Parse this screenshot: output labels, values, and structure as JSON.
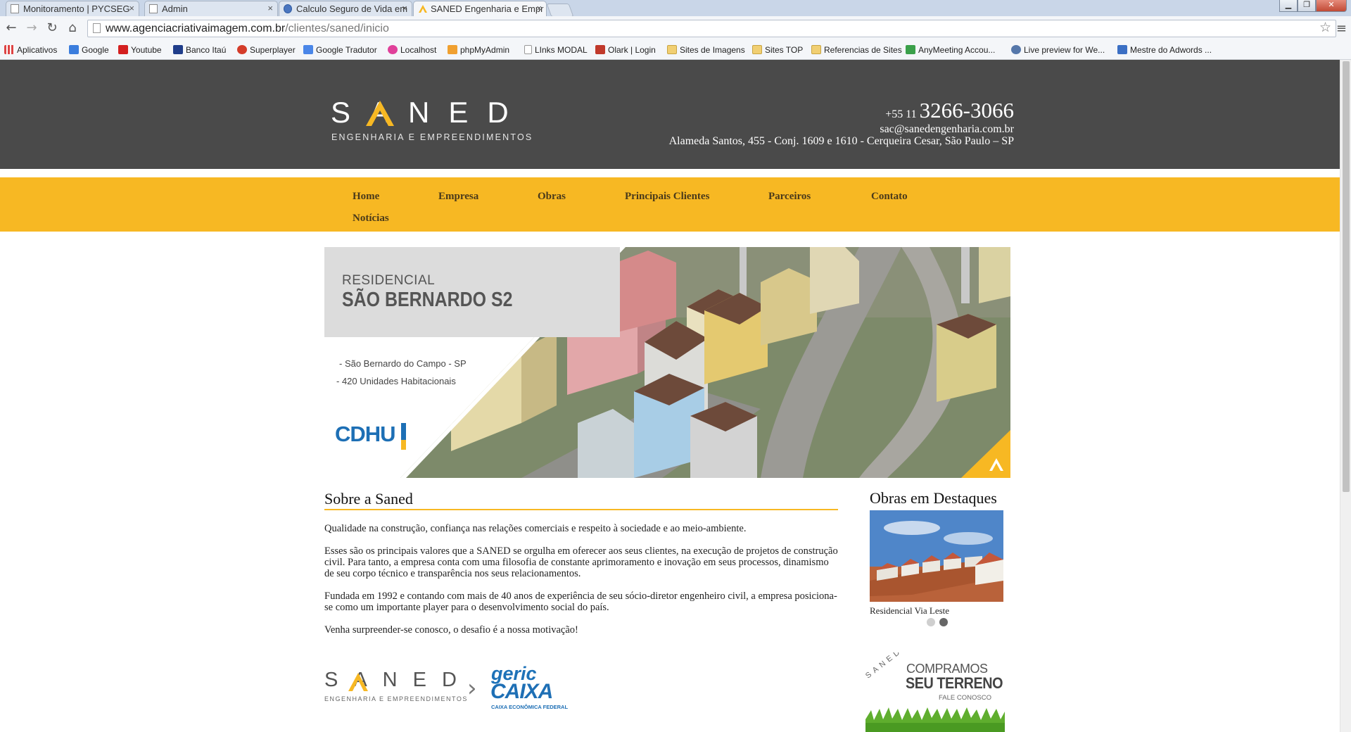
{
  "browser": {
    "tabs": [
      {
        "title": "Monitoramento | PYCSEG",
        "icon": "page-icon"
      },
      {
        "title": "Admin",
        "icon": "page-icon"
      },
      {
        "title": "Calculo Seguro de Vida em",
        "icon": "globe-icon"
      },
      {
        "title": "SANED Engenharia e Empr",
        "icon": "saned-logo-icon",
        "active": true
      }
    ],
    "tab_close_glyph": "×",
    "window_controls": {
      "minimize": "▁",
      "maximize": "❐",
      "close": "✕"
    },
    "url_host": "www.agenciacriativaimagem.com.br",
    "url_path": "/clientes/saned/inicio",
    "bookmarks": [
      {
        "label": "Aplicativos",
        "icon": "apps-icon"
      },
      {
        "label": "Google",
        "icon": "google-icon"
      },
      {
        "label": "Youtube",
        "icon": "youtube-icon"
      },
      {
        "label": "Banco Itaú",
        "icon": "itau-icon"
      },
      {
        "label": "Superplayer",
        "icon": "superplayer-icon"
      },
      {
        "label": "Google Tradutor",
        "icon": "translate-icon"
      },
      {
        "label": "Localhost",
        "icon": "localhost-icon"
      },
      {
        "label": "phpMyAdmin",
        "icon": "phpmyadmin-icon"
      },
      {
        "label": "LInks MODAL",
        "icon": "page-icon"
      },
      {
        "label": "Olark | Login",
        "icon": "olark-icon"
      },
      {
        "label": "Sites de Imagens",
        "icon": "folder-icon"
      },
      {
        "label": "Sites TOP",
        "icon": "folder-icon"
      },
      {
        "label": "Referencias de Sites",
        "icon": "folder-icon"
      },
      {
        "label": "AnyMeeting Accou...",
        "icon": "anymeeting-icon"
      },
      {
        "label": "Live preview for We...",
        "icon": "livepreview-icon"
      },
      {
        "label": "Mestre do Adwords ...",
        "icon": "adwords-icon"
      }
    ]
  },
  "header": {
    "logo_word": "SANED",
    "logo_tagline": "ENGENHARIA E EMPREENDIMENTOS",
    "phone_prefix": "+55 11",
    "phone_number": "3266-3066",
    "email": "sac@sanedengenharia.com.br",
    "address": "Alameda Santos, 455 - Conj. 1609 e 1610 - Cerqueira Cesar, São Paulo – SP"
  },
  "nav": {
    "items": [
      "Home",
      "Empresa",
      "Obras",
      "Principais Clientes",
      "Parceiros",
      "Contato",
      "Notícias"
    ]
  },
  "banner": {
    "pretitle": "RESIDENCIAL",
    "title": "SÃO BERNARDO S2",
    "bullets": [
      "- São Bernardo do Campo - SP",
      "- 420 Unidades Habitacionais"
    ],
    "client_logo": "CDHU"
  },
  "about": {
    "title": "Sobre a Saned",
    "paragraphs": [
      "Qualidade na construção, confiança nas relações comerciais e respeito à sociedade e ao meio-ambiente.",
      "Esses são os principais valores que a SANED se orgulha em oferecer aos seus clientes, na execução de projetos de construção civil. Para tanto, a empresa conta com uma filosofia de constante aprimoramento e inovação em seus processos, dinamismo de seu corpo técnico e transparência nos seus relacionamentos.",
      "Fundada em 1992 e contando com mais de 40 anos de experiência de seu sócio-diretor engenheiro civil, a empresa posiciona-se como um importante player para o desenvolvimento social do país.",
      "Venha surpreender-se conosco, o desafio é a nossa motivação!"
    ]
  },
  "footer_logos": {
    "saned_word": "SANED",
    "saned_tagline": "ENGENHARIA E EMPREENDIMENTOS",
    "arrow": "›",
    "geric": "geric",
    "caixa": "CAIXA",
    "caixa_sub": "CAIXA ECONÔMICA FEDERAL"
  },
  "featured": {
    "title": "Obras em Destaques",
    "caption": "Residencial Via Leste",
    "slides": 2,
    "active_slide": 2
  },
  "terreno_ad": {
    "brand": "SANED",
    "line1": "COMPRAMOS",
    "line2": "SEU TERRENO",
    "line3": "FALE CONOSCO"
  },
  "colors": {
    "header_bg": "#4a4a4a",
    "nav_bg": "#f7b823",
    "accent": "#f7b823",
    "cdhu_blue": "#1d6fb5"
  }
}
